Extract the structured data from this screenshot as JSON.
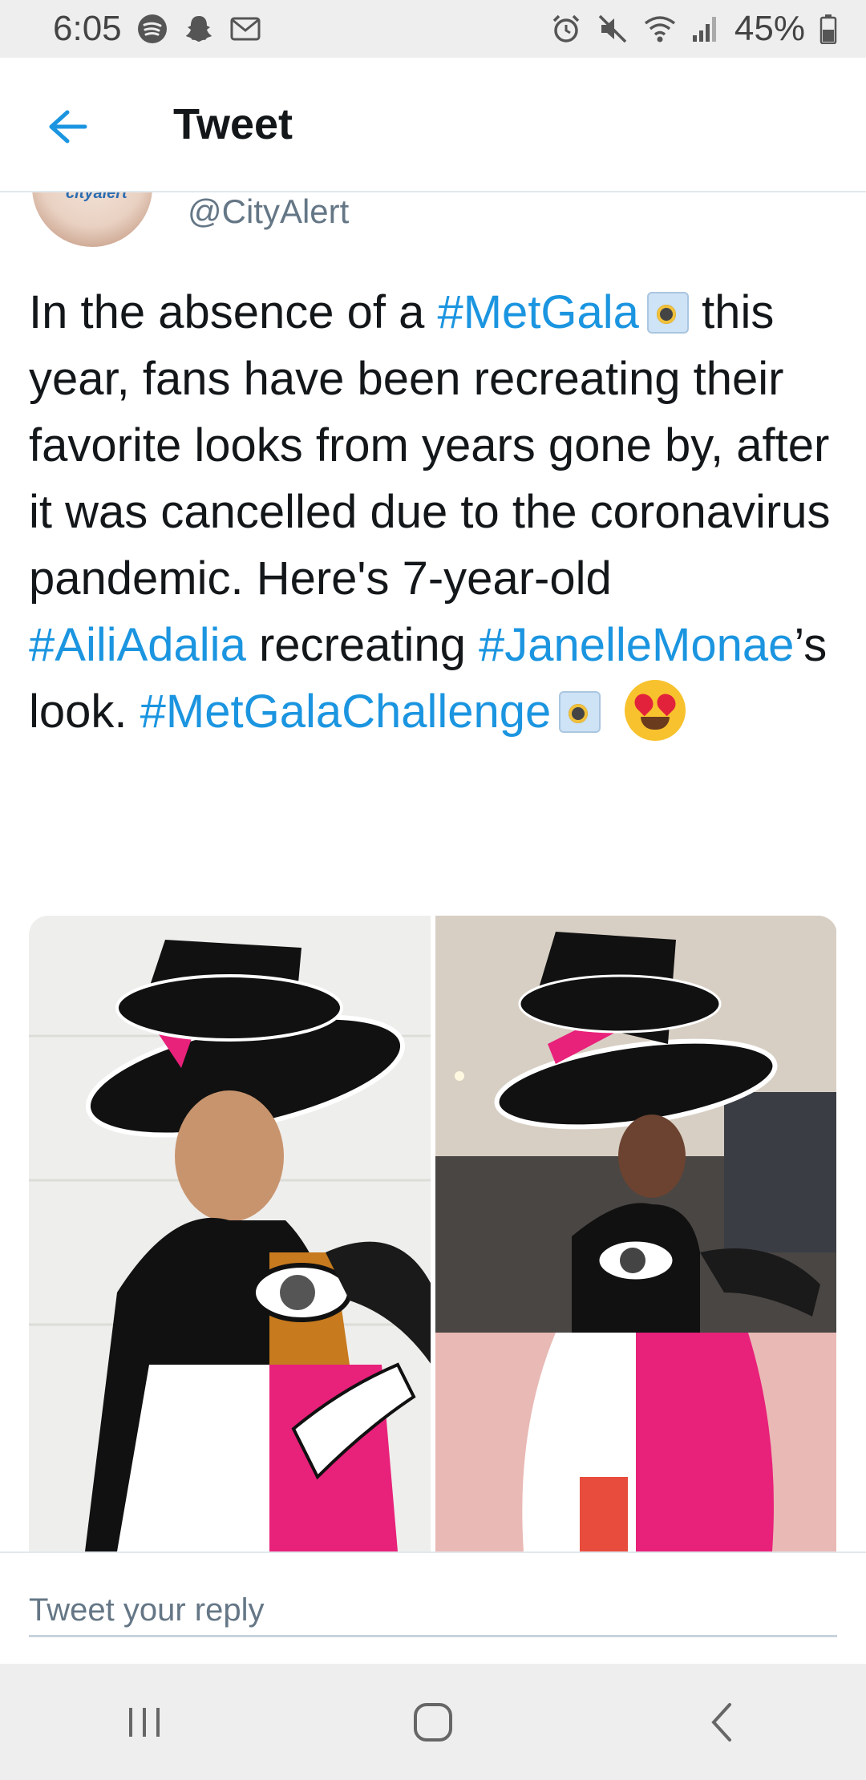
{
  "status_bar": {
    "time": "6:05",
    "battery": "45%",
    "icons_left": [
      "spotify-icon",
      "snapchat-icon",
      "gmail-icon"
    ],
    "icons_right": [
      "alarm-icon",
      "mute-icon",
      "wifi-icon",
      "signal-icon",
      "battery-icon"
    ]
  },
  "header": {
    "title": "Tweet",
    "accent": "#1b95e0"
  },
  "tweet": {
    "avatar_text": "cityalert",
    "handle": "@CityAlert",
    "text_part1": "In the absence of a ",
    "hashtag1": "#MetGala",
    "text_part2": " this year, fans have been recreating their favorite looks from years gone by, after it was cancelled due to the coronavirus pandemic. Here's 7-year-old ",
    "hashtag2": "#AiliAdalia",
    "text_part3": " recreating ",
    "hashtag3": "#JanelleMonae",
    "text_part4": "’s look. ",
    "hashtag4": "#MetGalaChallenge",
    "emoji1": "camera-emoji",
    "emoji2": "camera-emoji",
    "emoji3": "heart-eyes-emoji"
  },
  "reply": {
    "placeholder": "Tweet your reply"
  },
  "nav": {
    "items": [
      "recents-button",
      "home-button",
      "back-button"
    ]
  }
}
